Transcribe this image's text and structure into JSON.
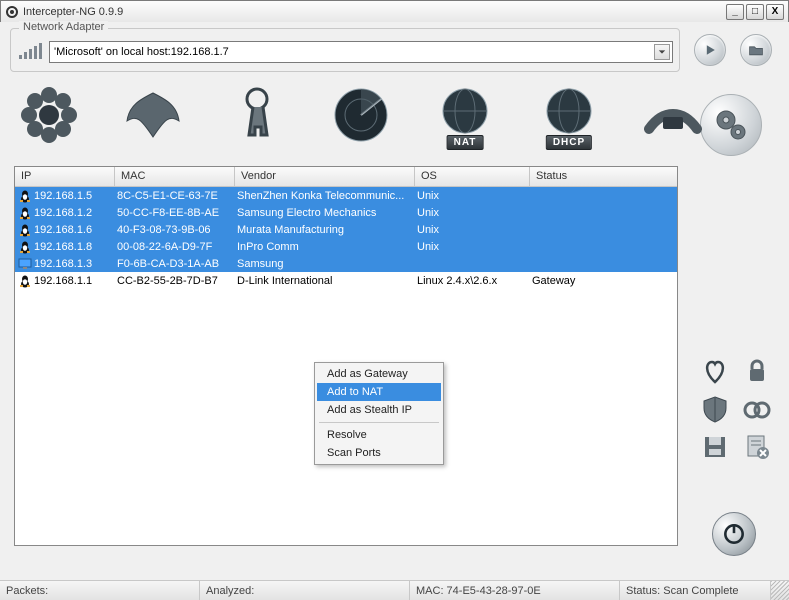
{
  "window": {
    "title": "Intercepter-NG 0.9.9"
  },
  "adapter": {
    "group_label": "Network Adapter",
    "value": "'Microsoft' on local host:192.168.1.7"
  },
  "toolbar_icons": {
    "nat_label": "NAT",
    "dhcp_label": "DHCP"
  },
  "table": {
    "headers": {
      "ip": "IP",
      "mac": "MAC",
      "vendor": "Vendor",
      "os": "OS",
      "status": "Status"
    },
    "rows": [
      {
        "icon": "penguin",
        "ip": "192.168.1.5",
        "mac": "8C-C5-E1-CE-63-7E",
        "vendor": "ShenZhen Konka Telecommunic...",
        "os": "Unix",
        "status": "",
        "selected": true
      },
      {
        "icon": "penguin",
        "ip": "192.168.1.2",
        "mac": "50-CC-F8-EE-8B-AE",
        "vendor": "Samsung Electro Mechanics",
        "os": "Unix",
        "status": "",
        "selected": true
      },
      {
        "icon": "penguin",
        "ip": "192.168.1.6",
        "mac": "40-F3-08-73-9B-06",
        "vendor": "Murata Manufacturing",
        "os": "Unix",
        "status": "",
        "selected": true
      },
      {
        "icon": "penguin",
        "ip": "192.168.1.8",
        "mac": "00-08-22-6A-D9-7F",
        "vendor": "InPro Comm",
        "os": "Unix",
        "status": "",
        "selected": true
      },
      {
        "icon": "monitor",
        "ip": "192.168.1.3",
        "mac": "F0-6B-CA-D3-1A-AB",
        "vendor": "Samsung",
        "os": "",
        "status": "",
        "selected": true
      },
      {
        "icon": "penguin",
        "ip": "192.168.1.1",
        "mac": "CC-B2-55-2B-7D-B7",
        "vendor": "D-Link International",
        "os": "Linux 2.4.x\\2.6.x",
        "status": "Gateway",
        "selected": false
      }
    ]
  },
  "context_menu": {
    "items": [
      {
        "label": "Add as Gateway",
        "highlighted": false
      },
      {
        "label": "Add to NAT",
        "highlighted": true
      },
      {
        "label": "Add as Stealth IP",
        "highlighted": false
      }
    ],
    "items2": [
      {
        "label": "Resolve"
      },
      {
        "label": "Scan Ports"
      }
    ]
  },
  "statusbar": {
    "packets": "Packets:",
    "analyzed": "Analyzed:",
    "mac": "MAC: 74-E5-43-28-97-0E",
    "status": "Status: Scan Complete"
  }
}
